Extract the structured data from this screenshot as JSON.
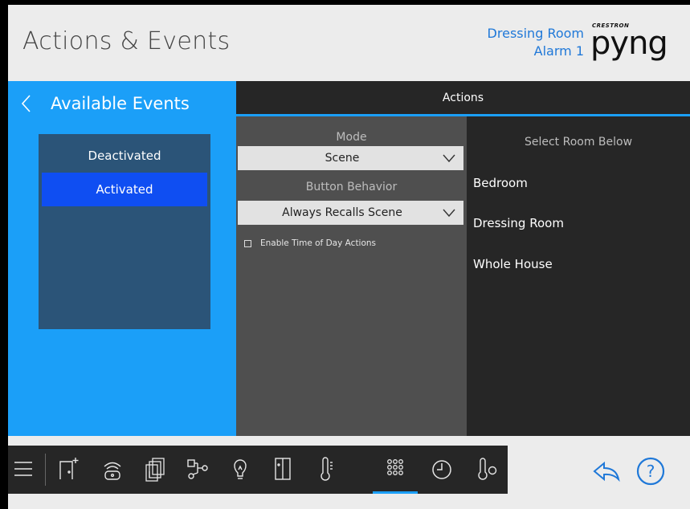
{
  "header": {
    "title": "Actions & Events",
    "room": "Dressing Room",
    "device": "Alarm 1",
    "logo_small": "CRESTRON",
    "logo_big": "pyng"
  },
  "left_panel": {
    "title": "Available Events",
    "events": [
      {
        "label": "Deactivated",
        "selected": false
      },
      {
        "label": "Activated",
        "selected": true
      }
    ]
  },
  "actions": {
    "title": "Actions",
    "mode_label": "Mode",
    "mode_value": "Scene",
    "behavior_label": "Button Behavior",
    "behavior_value": "Always Recalls Scene",
    "time_of_day_label": "Enable Time of Day Actions",
    "time_of_day_checked": false
  },
  "rooms": {
    "label": "Select Room Below",
    "items": [
      "Bedroom",
      "Dressing Room",
      "Whole House"
    ]
  },
  "bottom_nav": {
    "icons": [
      "menu-icon",
      "room-add-icon",
      "remote-icon",
      "shades-icon",
      "network-icon",
      "lightbulb-icon",
      "door-icon",
      "thermometer-icon",
      "keypad-icon",
      "clock-icon",
      "thermostat-icon"
    ],
    "active": "keypad-icon"
  },
  "colors": {
    "accent": "#1b9ff8",
    "selected_event": "#0f4ef2",
    "room_text": "#1f78d8"
  }
}
